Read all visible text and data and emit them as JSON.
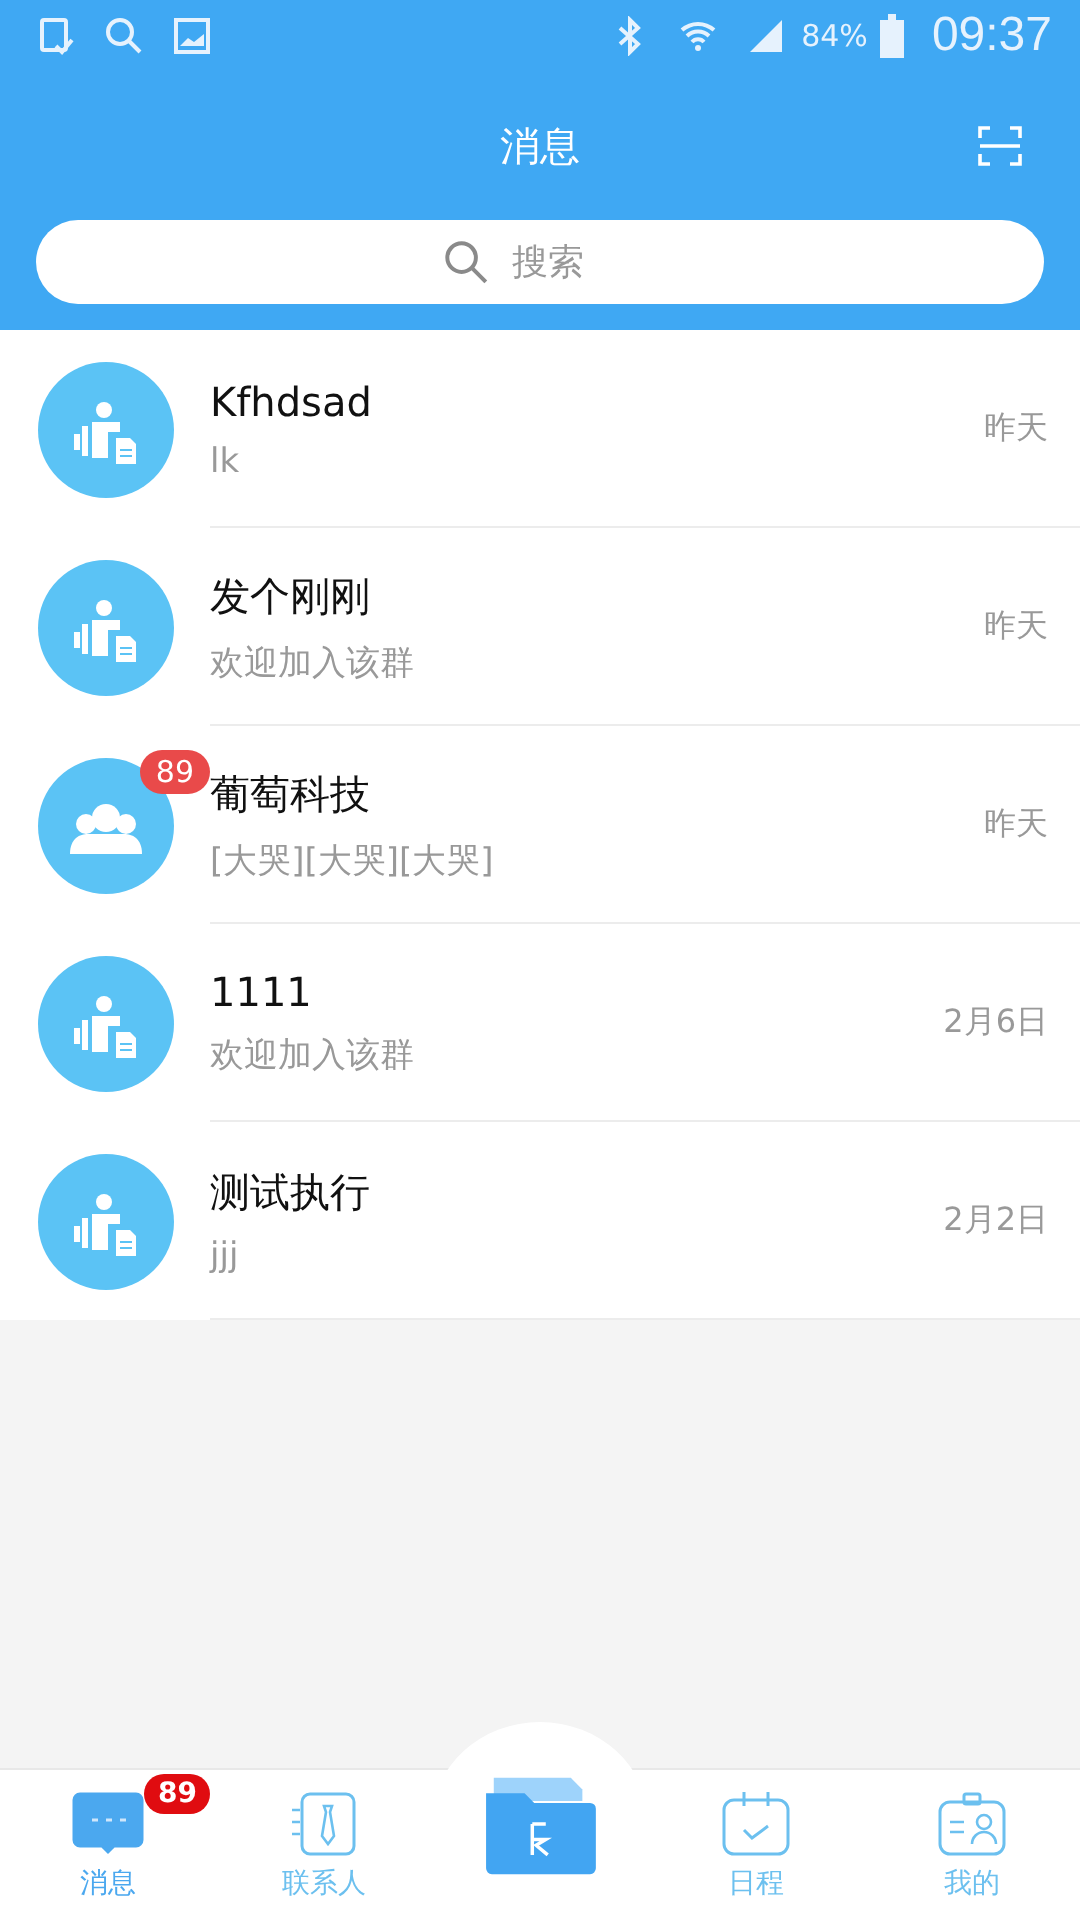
{
  "status_bar": {
    "battery": "84%",
    "time": "09:37"
  },
  "header": {
    "title": "消息"
  },
  "search": {
    "placeholder": "搜索"
  },
  "conversations": [
    {
      "kind": "person",
      "name": "Kfhdsad",
      "preview": "lk",
      "time": "昨天"
    },
    {
      "kind": "person",
      "name": "发个刚刚",
      "preview": "欢迎加入该群",
      "time": "昨天"
    },
    {
      "kind": "group",
      "name": "葡萄科技",
      "preview": "[大哭][大哭][大哭]",
      "time": "昨天",
      "badge": "89"
    },
    {
      "kind": "person",
      "name": "1111",
      "preview": "欢迎加入该群",
      "time": "2月6日"
    },
    {
      "kind": "person",
      "name": "测试执行",
      "preview": "jjj",
      "time": "2月2日"
    }
  ],
  "tabs": [
    {
      "kind": "chat",
      "label": "消息",
      "selected": true,
      "badge": "89"
    },
    {
      "kind": "contacts",
      "label": "联系人",
      "selected": false
    },
    {
      "kind": "folder"
    },
    {
      "kind": "calendar",
      "label": "日程",
      "selected": false
    },
    {
      "kind": "profile",
      "label": "我的",
      "selected": false
    }
  ]
}
